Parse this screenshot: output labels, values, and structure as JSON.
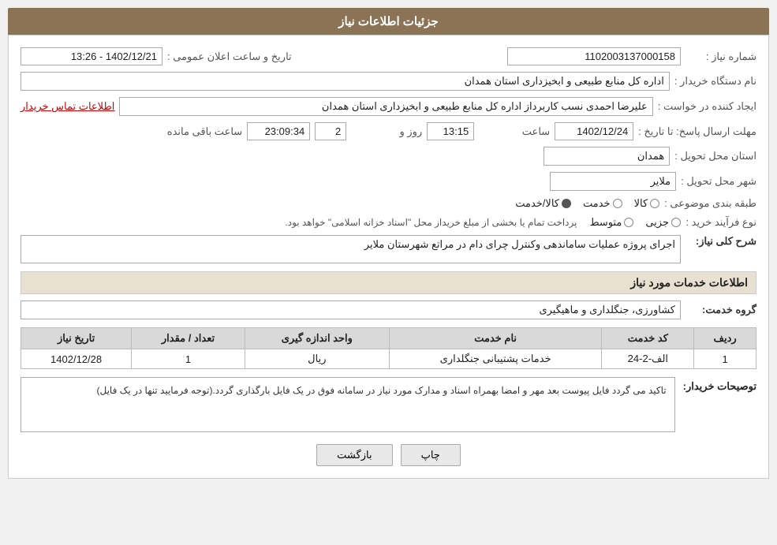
{
  "page": {
    "title": "جزئیات اطلاعات نیاز",
    "header": {
      "bg": "#8B7355",
      "label": "جزئیات اطلاعات نیاز"
    }
  },
  "fields": {
    "shomare_niaz_label": "شماره نیاز :",
    "shomare_niaz_value": "1102003137000158",
    "name_dastgah_label": "نام دستگاه خریدار :",
    "name_dastgah_value": "اداره کل منابع طبیعی و ابخیزداری استان همدان",
    "ijad_konande_label": "ایجاد کننده در خواست :",
    "ijad_konande_value": "علیرضا احمدی نسب کاربرداز اداره کل منابع طبیعی و ابخیزداری استان همدان",
    "contact_link": "اطلاعات تماس خریدار",
    "mohlat_label": "مهلت ارسال پاسخ: تا تاریخ :",
    "date_value": "1402/12/24",
    "saat_label": "ساعت",
    "saat_value": "13:15",
    "rooz_label": "روز و",
    "rooz_value": "2",
    "baqi_label": "ساعت باقی مانده",
    "baqi_value": "23:09:34",
    "tarikh_elan_label": "تاریخ و ساعت اعلان عمومی :",
    "tarikh_elan_value": "1402/12/21 - 13:26",
    "ostan_label": "استان محل تحویل :",
    "ostan_value": "همدان",
    "shahr_label": "شهر محل تحویل :",
    "shahr_value": "ملایر",
    "tabaqe_label": "طبقه بندی موضوعی :",
    "kala_label": "کالا",
    "khedmat_label": "خدمت",
    "kala_khedmat_label": "کالا/خدمت",
    "kala_selected": false,
    "khedmat_selected": false,
    "kala_khedmat_selected": true,
    "nooe_farayand_label": "نوع فرآیند خرید :",
    "jozyi_label": "جزیی",
    "motavaset_label": "متوسط",
    "nooe_note": "پرداخت تمام یا بخشی از مبلغ خریداز محل \"اسناد خزانه اسلامی\" خواهد بود.",
    "sharh_label": "شرح کلی نیاز:",
    "sharh_value": "اجرای پروژه عملیات ساماندهی وکنترل چرای دام در مراتع شهرستان ملایر",
    "section2_label": "اطلاعات خدمات مورد نیاز",
    "grooh_label": "گروه خدمت:",
    "grooh_value": "کشاورزی، جنگلداری و ماهیگیری",
    "table": {
      "headers": [
        "ردیف",
        "کد خدمت",
        "نام خدمت",
        "واحد اندازه گیری",
        "تعداد / مقدار",
        "تاریخ نیاز"
      ],
      "rows": [
        {
          "radif": "1",
          "kod": "الف-2-24",
          "name": "خدمات پشتیبانی جنگلداری",
          "vahed": "ریال",
          "tedad": "1",
          "tarikh": "1402/12/28"
        }
      ]
    },
    "buyer_notes_label": "توصیحات خریدار:",
    "buyer_notes_value": "تاکید می گردد فایل پیوست بعد مهر و امضا بهمراه اسناد و مدارک مورد نیاز در سامانه فوق در یک فایل بارگذاری گردد.(توجه فرمایید تنها در یک فایل)",
    "btn_back": "بازگشت",
    "btn_print": "چاپ"
  }
}
